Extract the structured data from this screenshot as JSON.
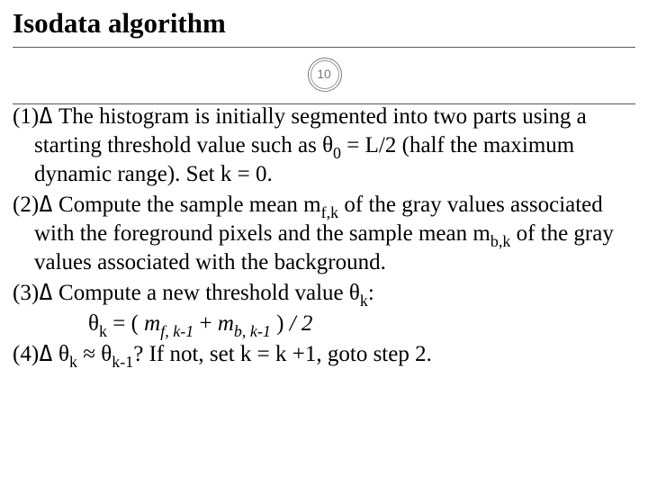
{
  "title": "Isodata algorithm",
  "page_number": "10",
  "bullet_glyph": "ߡ",
  "items": [
    {
      "num": "(1)",
      "html": "The histogram is initially segmented into two parts using a starting threshold value such as θ<span class=\"sub\">0</span> = L/2 (half the maximum dynamic range). Set  k = 0."
    },
    {
      "num": "(2)",
      "html": "Compute the sample mean m<span class=\"sub\">f,k</span> of the gray values associated with the foreground pixels and the sample mean m<span class=\"sub\">b,k</span>  of the gray values associated with the background."
    },
    {
      "num": "(3)",
      "html": "Compute a new threshold value θ<span class=\"sub\">k</span>:",
      "sub_html": "θ<span class=\"sub\">k</span> =  ( <span class=\"ital\">m<span class=\"sub\">f, k-1</span></span>  +  <span class=\"ital\">m<span class=\"sub\">b, k-1</span></span> ) <span class=\"ital\">/ 2</span>"
    },
    {
      "num": "(4)",
      "html": "θ<span class=\"sub\">k</span> ≈ θ<span class=\"sub\">k-1</span>?  If not, set k = k +1, goto step 2."
    }
  ]
}
